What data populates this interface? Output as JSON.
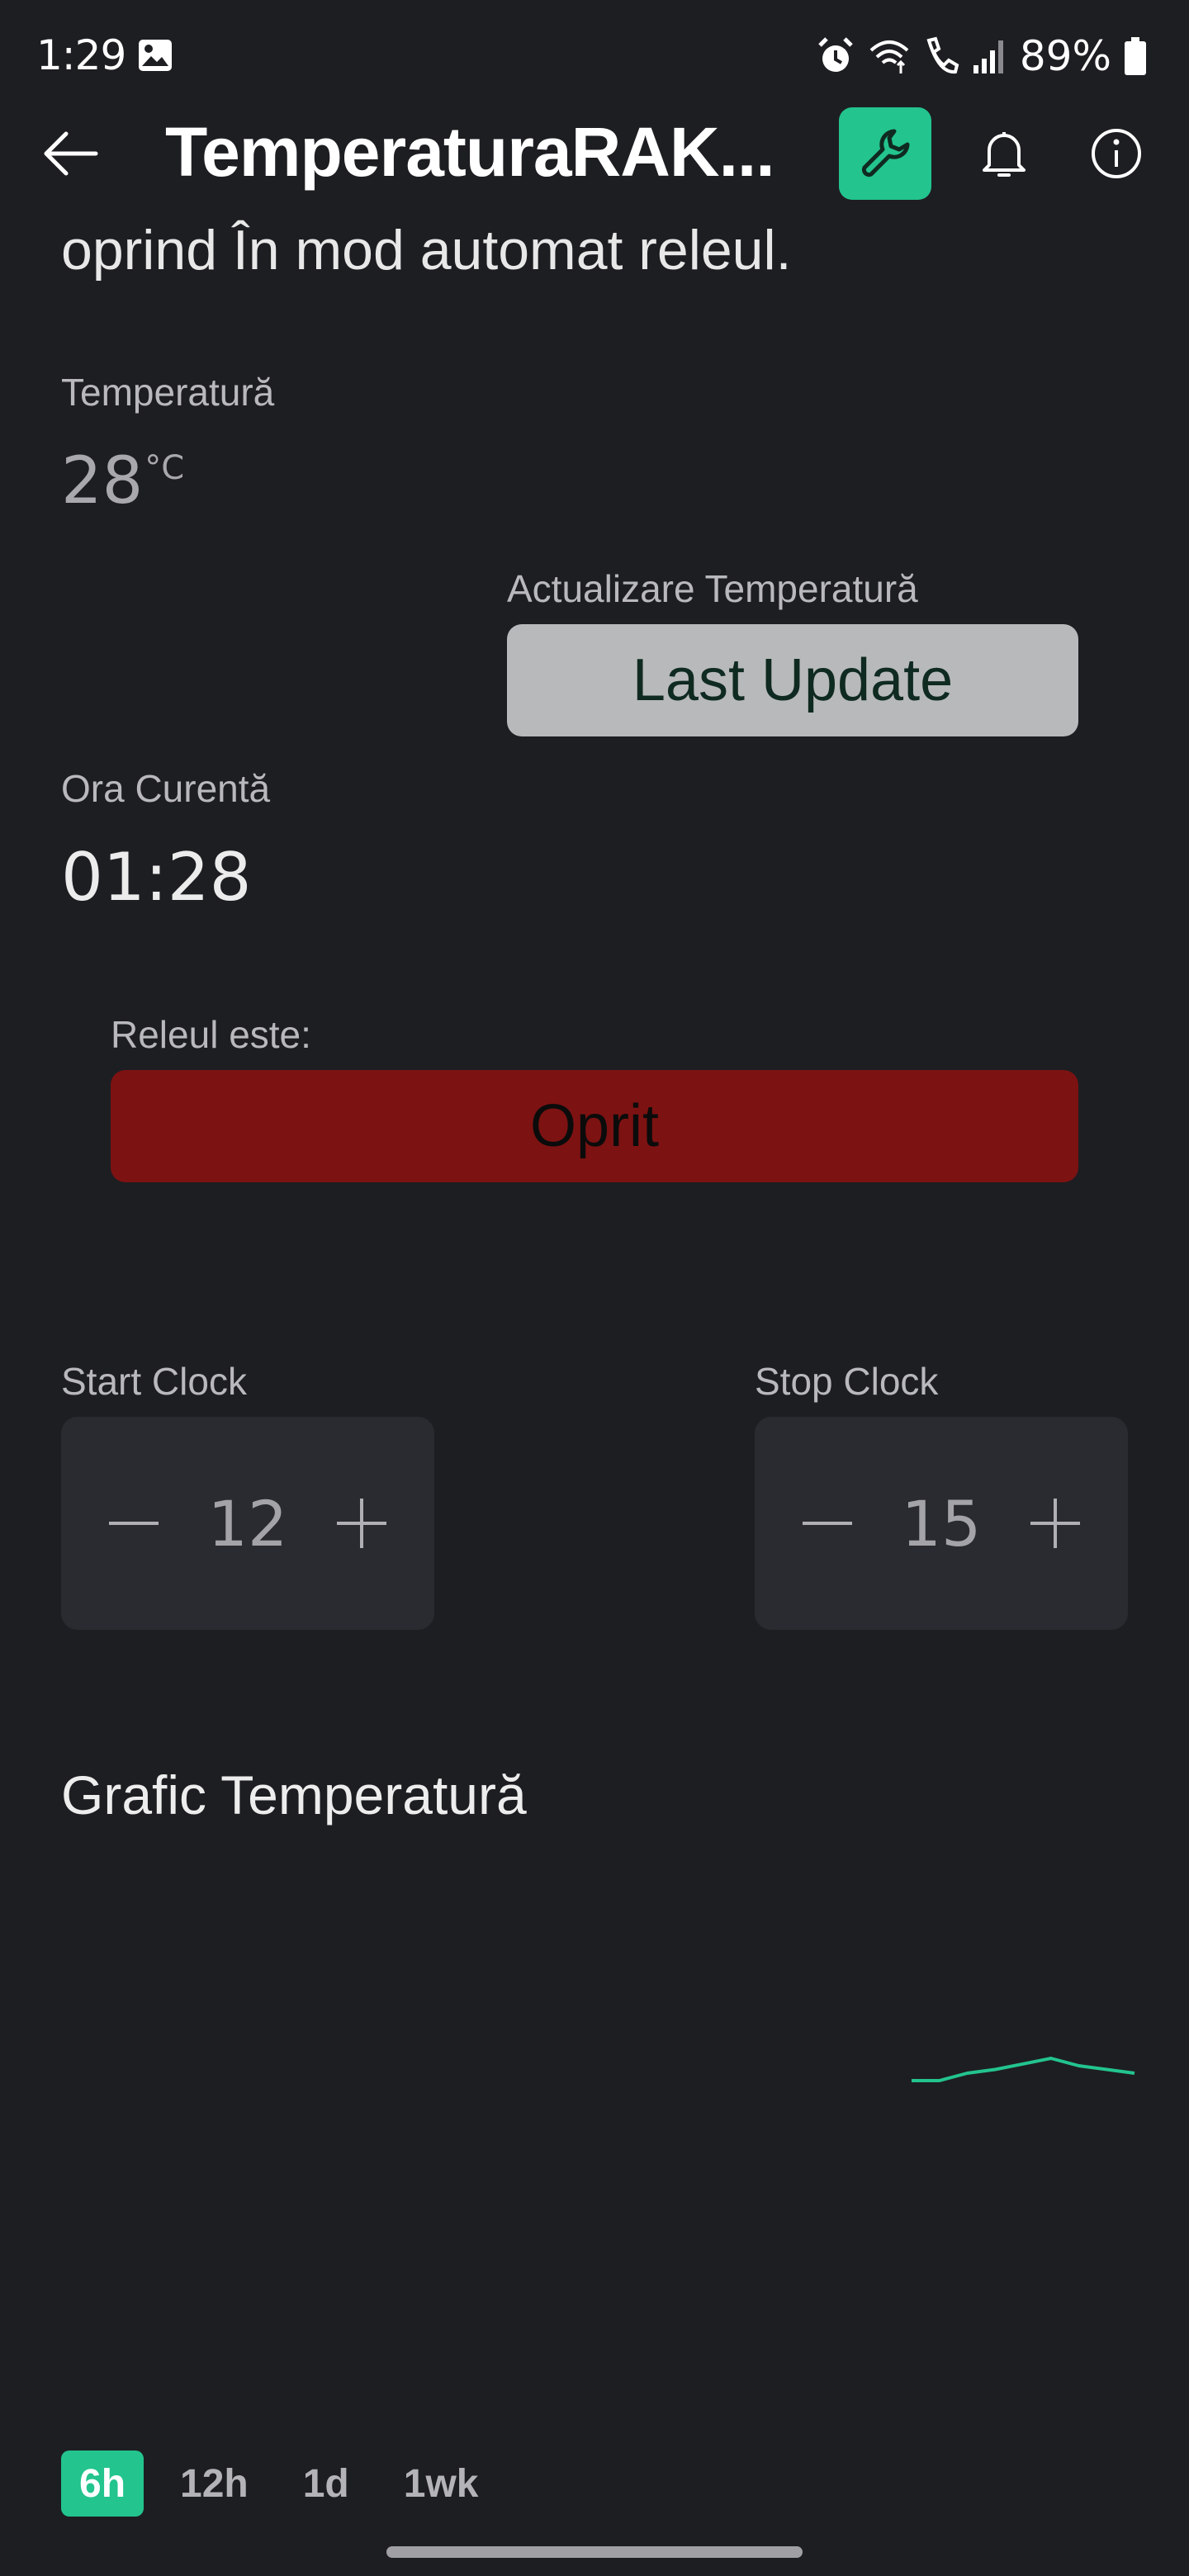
{
  "status_bar": {
    "time": "1:29",
    "battery": "89%"
  },
  "header": {
    "title": "TemperaturaRAK..."
  },
  "description": "oprind În mod automat releul.",
  "temperature": {
    "label": "Temperatură",
    "value": "28",
    "unit": "°C"
  },
  "update": {
    "label": "Actualizare Temperatură",
    "button_label": "Last Update"
  },
  "current_time": {
    "label": "Ora Curentă",
    "value": "01:28"
  },
  "relay": {
    "label": "Releul este:",
    "status": "Oprit",
    "status_color": "#7d1212"
  },
  "start_clock": {
    "label": "Start Clock",
    "value": "12"
  },
  "stop_clock": {
    "label": "Stop Clock",
    "value": "15"
  },
  "chart": {
    "title": "Grafic Temperatură"
  },
  "chart_data": {
    "type": "line",
    "title": "Grafic Temperatură",
    "xlabel": "",
    "ylabel": "",
    "grid": false,
    "series": [
      {
        "color": "#23c48e",
        "values": [
          27.6,
          27.6,
          28.0,
          28.2,
          28.5,
          28.8,
          28.4,
          28.2,
          28.0
        ]
      }
    ]
  },
  "range_tabs": [
    {
      "label": "6h",
      "active": true
    },
    {
      "label": "12h",
      "active": false
    },
    {
      "label": "1d",
      "active": false
    },
    {
      "label": "1wk",
      "active": false
    }
  ],
  "colors": {
    "accent": "#23c48e",
    "background": "#1d1e22",
    "relay_off": "#7d1212"
  },
  "icons": [
    "back-arrow-icon",
    "wrench-icon",
    "bell-icon",
    "info-icon",
    "minus-icon",
    "plus-icon",
    "image-icon",
    "alarm-icon",
    "wifi-icon",
    "call-icon",
    "signal-icon",
    "battery-icon"
  ]
}
